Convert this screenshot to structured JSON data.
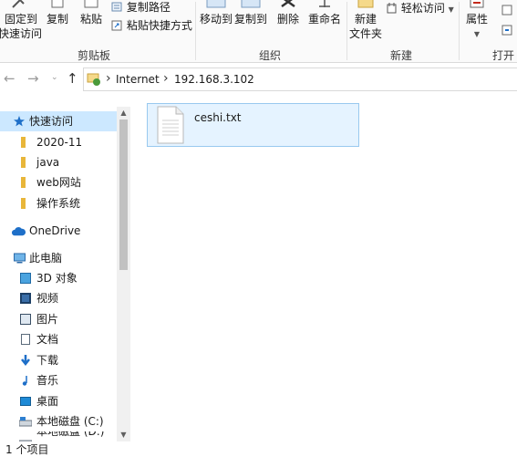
{
  "ribbon": {
    "clipboard": {
      "pin_label_line1": "固定到",
      "pin_label_line2": "快速访问",
      "copy_label": "复制",
      "paste_label": "粘贴",
      "copy_path_label": "复制路径",
      "paste_shortcut_label": "粘贴快捷方式",
      "group_label": "剪贴板"
    },
    "organize": {
      "move_to_label": "移动到",
      "copy_to_label": "复制到",
      "delete_label": "删除",
      "rename_label": "重命名",
      "group_label": "组织"
    },
    "new": {
      "new_folder_line1": "新建",
      "new_folder_line2": "文件夹",
      "easy_access_label": "轻松访问",
      "group_label": "新建"
    },
    "open": {
      "properties_label": "属性",
      "group_label": "打开"
    }
  },
  "address": {
    "segments": [
      "Internet",
      "192.168.3.102"
    ],
    "separator": "›"
  },
  "sidebar": {
    "quick_access": "快速访问",
    "quick_items": [
      "2020-11",
      "java",
      "web网站",
      "操作系统"
    ],
    "onedrive": "OneDrive",
    "this_pc": "此电脑",
    "pc_items": [
      "3D 对象",
      "视频",
      "图片",
      "文档",
      "下载",
      "音乐",
      "桌面",
      "本地磁盘 (C:)"
    ],
    "partial_item": "本地磁盘 (D:)"
  },
  "content": {
    "file_name": "ceshi.txt"
  },
  "status": {
    "item_count": "1 个项目"
  },
  "colors": {
    "selected_bg": "#cce8ff",
    "tile_border": "#99c9ef",
    "folder": "#e8b63a",
    "accent_blue": "#1e6fc8"
  }
}
